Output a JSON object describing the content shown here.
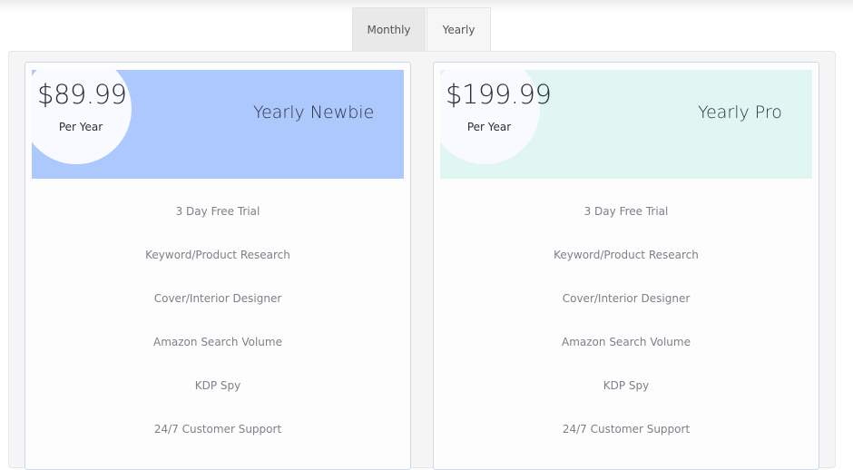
{
  "tabs": [
    {
      "label": "Monthly"
    },
    {
      "label": "Yearly"
    }
  ],
  "plans": [
    {
      "price": "$89.99",
      "period": "Per Year",
      "name": "Yearly Newbie",
      "header_color": "#adc8fd",
      "features": [
        "3 Day Free Trial",
        "Keyword/Product Research",
        "Cover/Interior Designer",
        "Amazon Search Volume",
        "KDP Spy",
        "24/7 Customer Support"
      ]
    },
    {
      "price": "$199.99",
      "period": "Per Year",
      "name": "Yearly Pro",
      "header_color": "#e0f6f2",
      "features": [
        "3 Day Free Trial",
        "Keyword/Product Research",
        "Cover/Interior Designer",
        "Amazon Search Volume",
        "KDP Spy",
        "24/7 Customer Support"
      ]
    }
  ]
}
